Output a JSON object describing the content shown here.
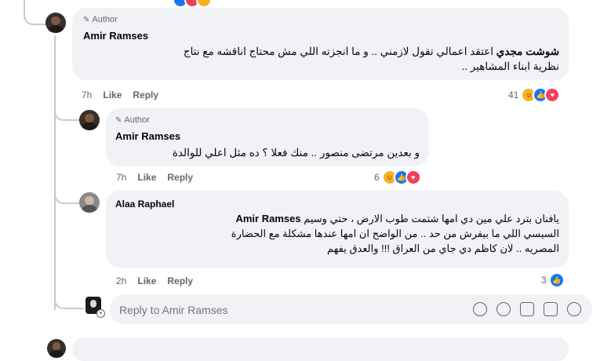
{
  "top_reactions_partial": true,
  "comments": [
    {
      "author_badge": "Author",
      "name": "Amir Ramses",
      "mention": "شوشت مجدي",
      "text_line1": "اعتقد اعمالي تقول لازمني .. و ما انجزته اللي مش محتاج اناقشه مع نتاج",
      "text_line2": "نظرية ابناء المشاهير ..",
      "time": "7h",
      "like": "Like",
      "reply": "Reply",
      "reaction_count": "41"
    },
    {
      "author_badge": "Author",
      "name": "Amir Ramses",
      "text_line1": "و بعدين مرتضى منصور .. منك فعلا ؟ ده مثل اعلي للوالدة",
      "time": "7h",
      "like": "Like",
      "reply": "Reply",
      "reaction_count": "6"
    },
    {
      "name": "Alaa Raphael",
      "mention": "Amir Ramses",
      "text_line1": "يافنان بترد علي مين دي امها شتمت طوب الارض ، حتي وسيم",
      "text_line2": "السيسي اللي ما بيفرش من حد .. من الواضح ان امها عندها مشكلة مع الحضارة",
      "text_line3": "المصريه .. لان كاظم دي جاي من العراق !!! والعدق يفهم",
      "time": "2h",
      "like": "Like",
      "reply": "Reply",
      "reaction_count": "3"
    }
  ],
  "reply_box": {
    "placeholder": "Reply to Amir Ramses"
  },
  "colors": {
    "bubble": "#f0f2f5",
    "muted_text": "#65676b",
    "like_blue": "#1877f2",
    "love_red": "#f33e58",
    "haha_yellow": "#f7b125"
  }
}
